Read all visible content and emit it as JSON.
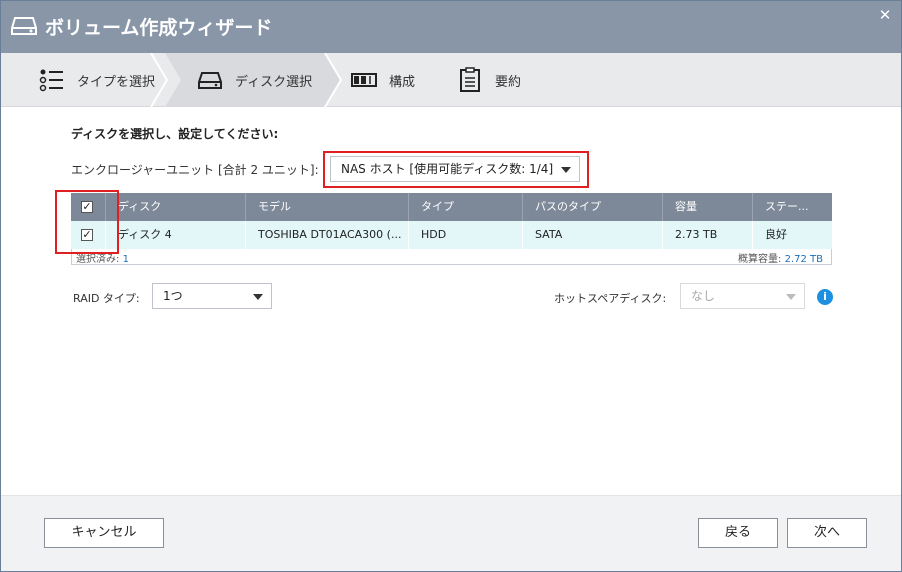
{
  "window": {
    "title": "ボリューム作成ウィザード",
    "close_glyph": "✕"
  },
  "steps": [
    {
      "label": "タイプを選択",
      "icon": "list-icon"
    },
    {
      "label": "ディスク選択",
      "icon": "disk-icon"
    },
    {
      "label": "構成",
      "icon": "config-icon"
    },
    {
      "label": "要約",
      "icon": "summary-icon"
    }
  ],
  "main": {
    "heading": "ディスクを選択し、設定してください:",
    "enclosure_label": "エンクロージャーユニット [合計 2 ユニット]:",
    "enclosure_value": "NAS ホスト [使用可能ディスク数: 1/4]"
  },
  "table": {
    "headers": [
      "ディスク",
      "モデル",
      "タイプ",
      "パスのタイプ",
      "容量",
      "ステー..."
    ],
    "rows": [
      {
        "checked": "✓",
        "disk": "ディスク 4",
        "model": "TOSHIBA DT01ACA300 (...",
        "type": "HDD",
        "path": "SATA",
        "capacity": "2.73 TB",
        "status": "良好"
      }
    ],
    "header_check": "✓",
    "selected_label": "選択済み:",
    "selected_count": "1",
    "capacity_label": "概算容量:",
    "capacity_value": "2.72 TB"
  },
  "raid": {
    "label": "RAID タイプ:",
    "value": "1つ"
  },
  "spare": {
    "label": "ホットスペアディスク:",
    "value": "なし",
    "info_glyph": "i"
  },
  "buttons": {
    "cancel": "キャンセル",
    "back": "戻る",
    "next": "次へ"
  },
  "colors": {
    "titlebar": "#8896a8",
    "highlight": "#e02020",
    "accent": "#1a6fb8",
    "row_bg": "#e3f7f9"
  }
}
